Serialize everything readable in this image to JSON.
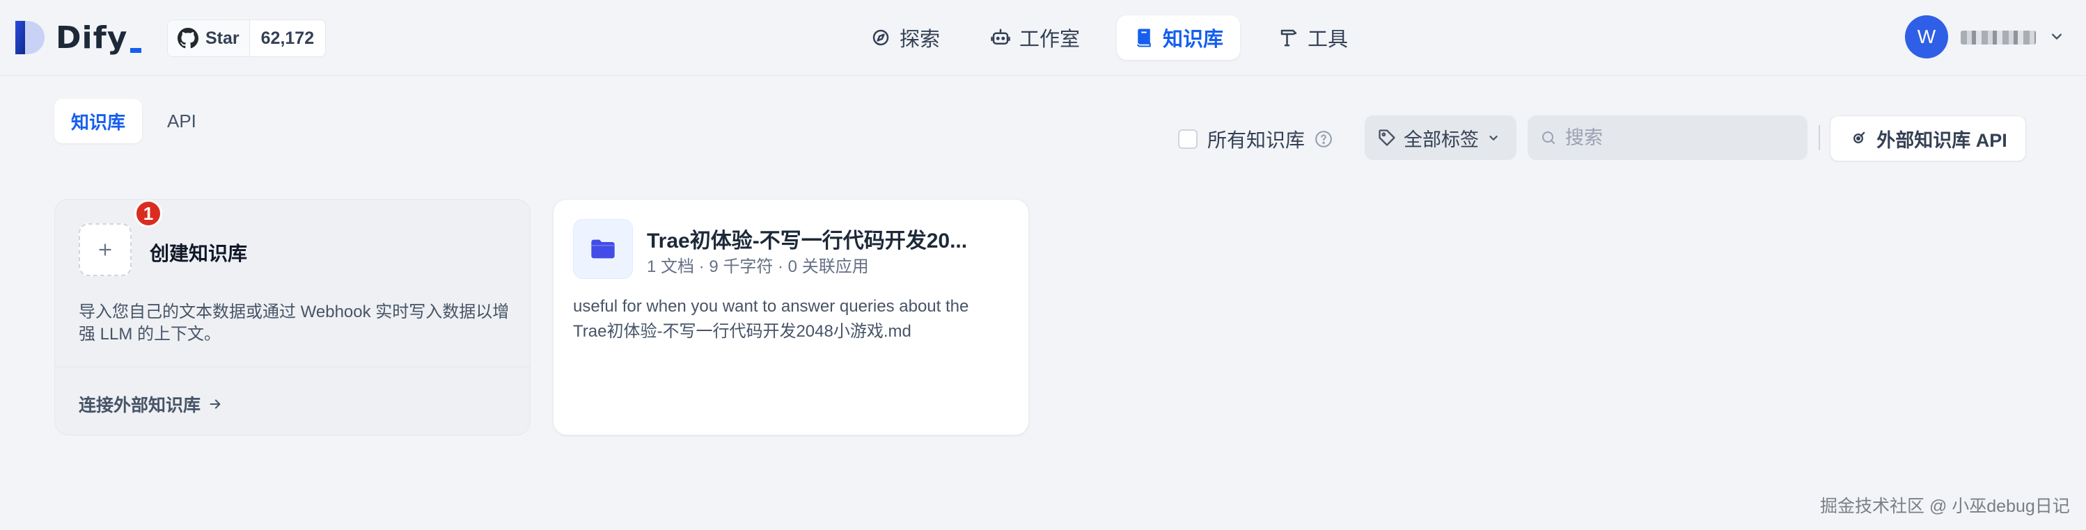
{
  "app": {
    "name": "Dify"
  },
  "github": {
    "star_label": "Star",
    "star_count": "62,172"
  },
  "nav": [
    {
      "label": "探索",
      "icon": "compass-icon",
      "active": false
    },
    {
      "label": "工作室",
      "icon": "robot-icon",
      "active": false
    },
    {
      "label": "知识库",
      "icon": "book-icon",
      "active": true
    },
    {
      "label": "工具",
      "icon": "hammer-icon",
      "active": false
    }
  ],
  "user": {
    "avatar_initial": "W"
  },
  "tabs": [
    {
      "label": "知识库",
      "active": true
    },
    {
      "label": "API",
      "active": false
    }
  ],
  "toolbar": {
    "all_datasets_label": "所有知识库",
    "tags_label": "全部标签",
    "search_placeholder": "搜索",
    "external_api_label": "外部知识库 API"
  },
  "create_card": {
    "badge": "1",
    "title": "创建知识库",
    "description": "导入您自己的文本数据或通过 Webhook 实时写入数据以增强 LLM 的上下文。",
    "connect_label": "连接外部知识库"
  },
  "datasets": [
    {
      "title": "Trae初体验-不写一行代码开发20...",
      "meta": "1 文档 · 9 千字符 · 0 关联应用",
      "description": "useful for when you want to answer queries about the Trae初体验-不写一行代码开发2048小游戏.md",
      "icon": "folder-icon"
    }
  ],
  "watermark": "掘金技术社区 @ 小巫debug日记",
  "colors": {
    "accent": "#155eef",
    "background": "#f2f4f7",
    "badge": "#d92d20",
    "avatar": "#2e5fe6"
  }
}
